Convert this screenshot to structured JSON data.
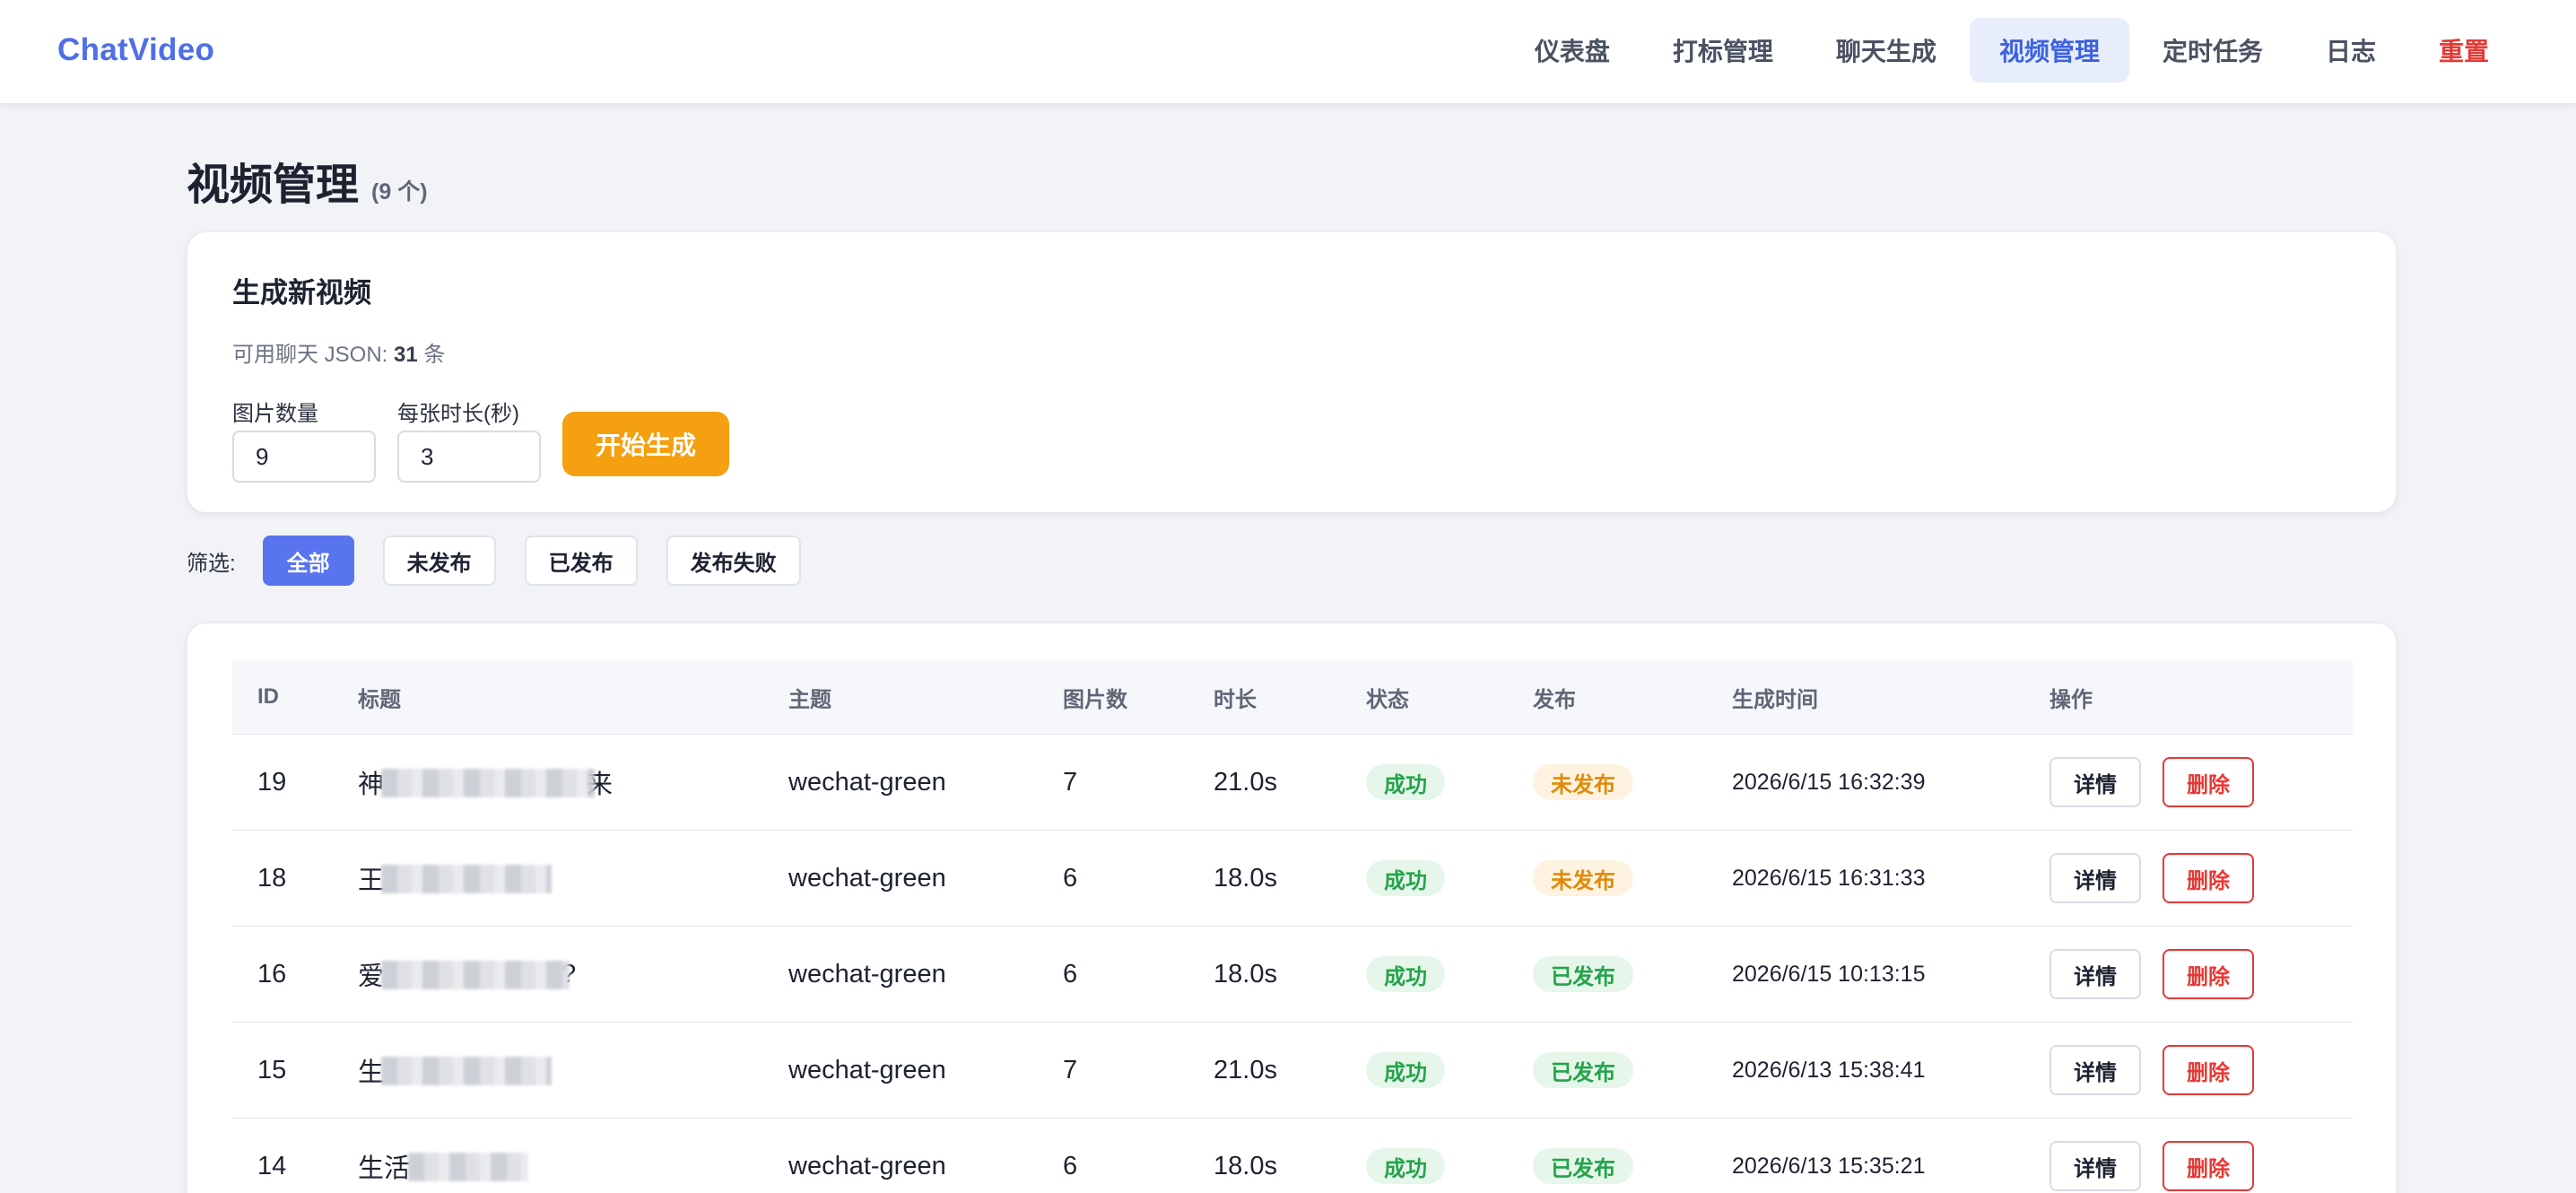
{
  "app": {
    "brand": "ChatVideo",
    "accent": "#4f6fe8"
  },
  "nav": {
    "items": [
      {
        "label": "仪表盘",
        "key": "dashboard",
        "active": false
      },
      {
        "label": "打标管理",
        "key": "tagging",
        "active": false
      },
      {
        "label": "聊天生成",
        "key": "chat",
        "active": false
      },
      {
        "label": "视频管理",
        "key": "videos",
        "active": true
      },
      {
        "label": "定时任务",
        "key": "schedule",
        "active": false
      },
      {
        "label": "日志",
        "key": "logs",
        "active": false
      },
      {
        "label": "重置",
        "key": "reset",
        "active": false,
        "danger": true
      }
    ]
  },
  "page": {
    "title": "视频管理",
    "count": "(9 个)"
  },
  "generate": {
    "heading": "生成新视频",
    "meta_prefix": "可用聊天 JSON: ",
    "meta_value": "31",
    "meta_suffix": " 条",
    "count_label": "图片数量",
    "count_value": "9",
    "duration_label": "每张时长(秒)",
    "duration_value": "3",
    "start_label": "开始生成",
    "start_color": "#f5a011"
  },
  "filter": {
    "label": "筛选:",
    "options": [
      {
        "label": "全部",
        "active": true
      },
      {
        "label": "未发布",
        "active": false
      },
      {
        "label": "已发布",
        "active": false
      },
      {
        "label": "发布失败",
        "active": false
      }
    ]
  },
  "table": {
    "columns": [
      "ID",
      "标题",
      "主题",
      "图片数",
      "时长",
      "状态",
      "发布",
      "生成时间",
      "操作"
    ],
    "detail_label": "详情",
    "delete_label": "删除",
    "rows": [
      {
        "id": "19",
        "title_start": "神",
        "title_end": "来",
        "blur_width": 238,
        "theme": "wechat-green",
        "images": "7",
        "duration": "21.0s",
        "status": "成功",
        "publish": "未发布",
        "publish_state": "unpublished",
        "time": "2026/6/15 16:32:39"
      },
      {
        "id": "18",
        "title_start": "王",
        "title_end": "",
        "blur_width": 190,
        "theme": "wechat-green",
        "images": "6",
        "duration": "18.0s",
        "status": "成功",
        "publish": "未发布",
        "publish_state": "unpublished",
        "time": "2026/6/15 16:31:33"
      },
      {
        "id": "16",
        "title_start": "爱",
        "title_end": "?",
        "blur_width": 210,
        "theme": "wechat-green",
        "images": "6",
        "duration": "18.0s",
        "status": "成功",
        "publish": "已发布",
        "publish_state": "published",
        "time": "2026/6/15 10:13:15"
      },
      {
        "id": "15",
        "title_start": "生",
        "title_end": "",
        "blur_width": 190,
        "theme": "wechat-green",
        "images": "7",
        "duration": "21.0s",
        "status": "成功",
        "publish": "已发布",
        "publish_state": "published",
        "time": "2026/6/13 15:38:41"
      },
      {
        "id": "14",
        "title_start": "生活",
        "title_end": "",
        "blur_width": 134,
        "theme": "wechat-green",
        "images": "6",
        "duration": "18.0s",
        "status": "成功",
        "publish": "已发布",
        "publish_state": "published",
        "time": "2026/6/13 15:35:21"
      }
    ]
  }
}
